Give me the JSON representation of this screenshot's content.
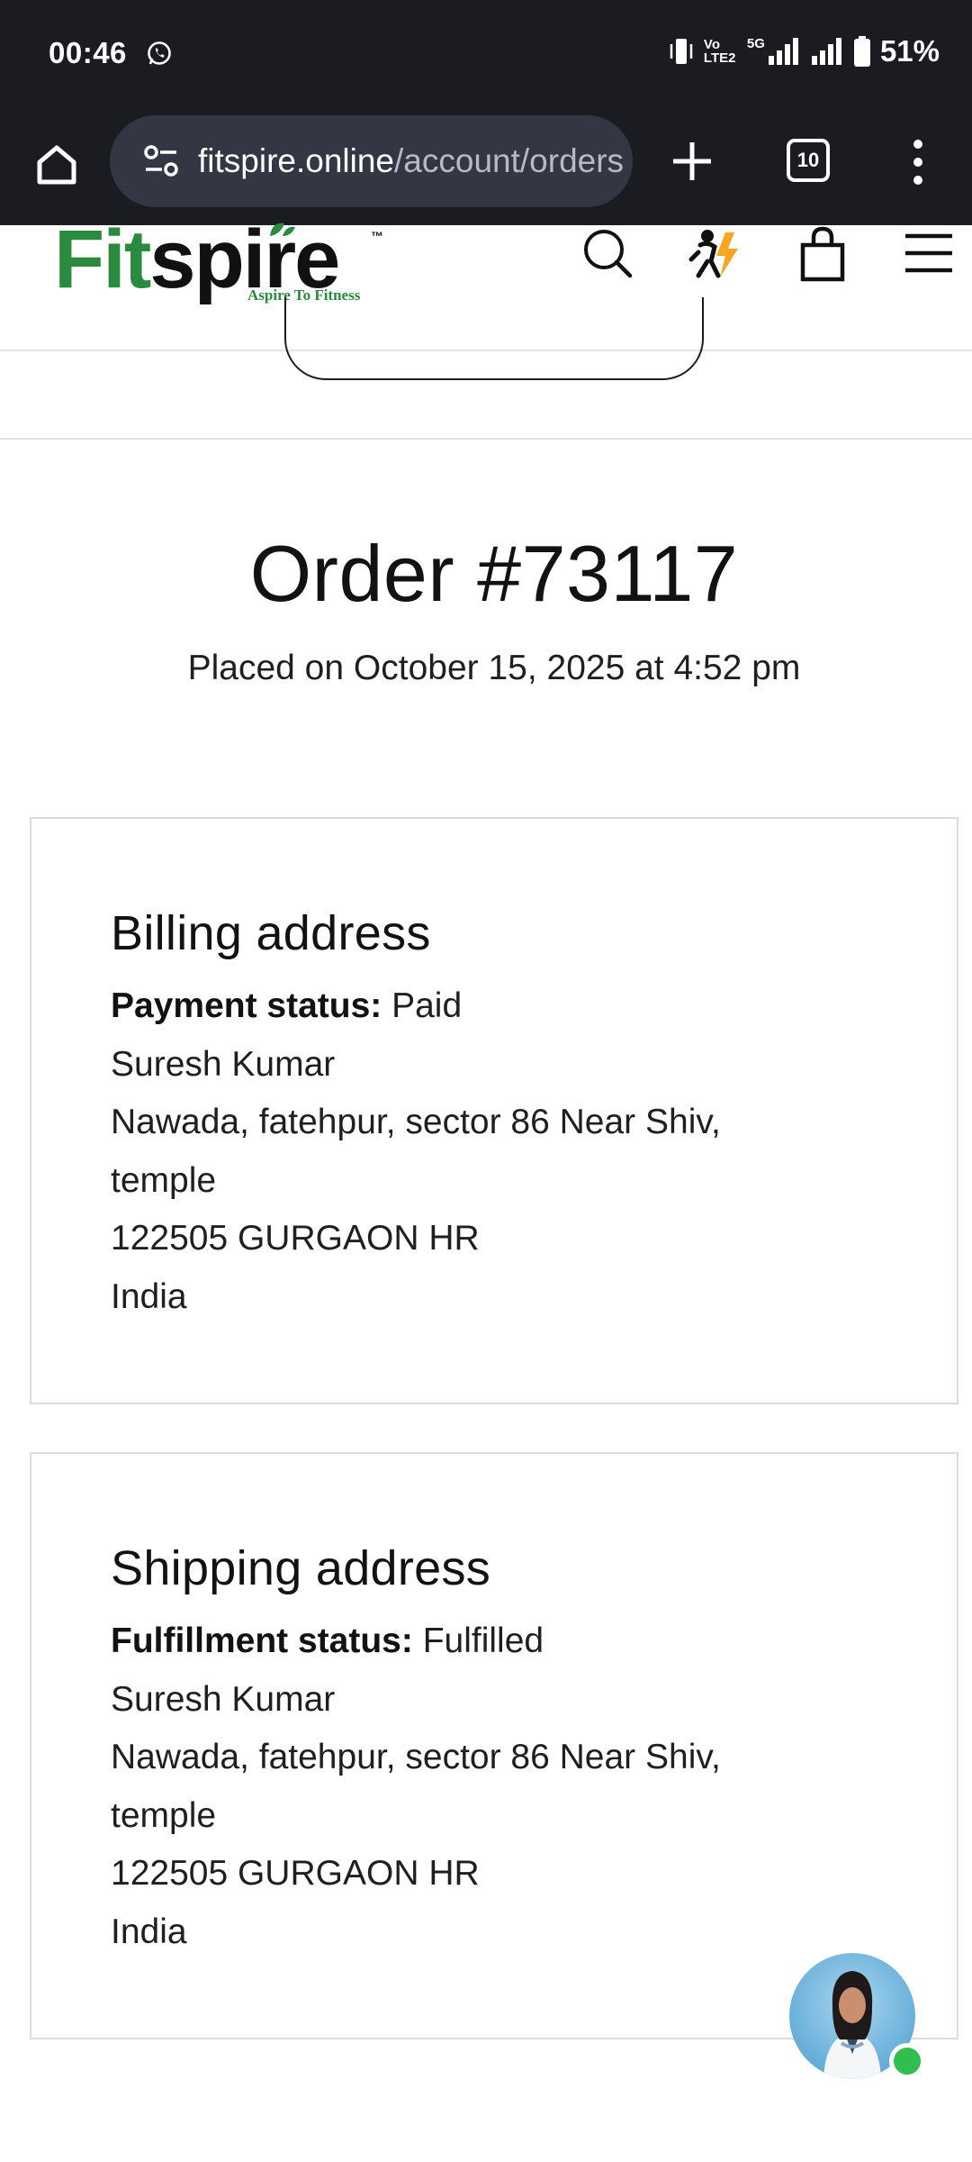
{
  "status_bar": {
    "time": "00:46",
    "network_label": "Vo LTE2",
    "network_type": "5G",
    "battery": "51%",
    "icons": [
      "whatsapp-icon",
      "vibrate-icon",
      "signal-icon",
      "signal-icon",
      "battery-icon"
    ]
  },
  "browser": {
    "url_host": "fitspire.online",
    "url_path": "/account/orders",
    "tab_count": "10",
    "icons": [
      "home-icon",
      "site-settings-icon",
      "plus-icon",
      "tabs-icon",
      "more-vert-icon"
    ]
  },
  "site": {
    "logo_fit": "Fit",
    "logo_spire": "spire",
    "logo_tm": "™",
    "logo_tagline": "Aspire To Fitness",
    "header_icons": [
      "search-icon",
      "coach-icon",
      "bag-icon",
      "menu-icon"
    ]
  },
  "order": {
    "title": "Order #73117",
    "placed_on": "Placed on October 15, 2025 at 4:52 pm"
  },
  "billing": {
    "heading": "Billing address",
    "status_label": "Payment status:",
    "status_value": "Paid",
    "name": "Suresh Kumar",
    "address_line1": "Nawada, fatehpur, sector 86 Near Shiv,",
    "address_line2": "temple",
    "city_line": "122505 GURGAON HR",
    "country": "India"
  },
  "shipping": {
    "heading": "Shipping address",
    "status_label": "Fulfillment status:",
    "status_value": "Fulfilled",
    "name": "Suresh Kumar",
    "address_line1": "Nawada, fatehpur, sector 86 Near Shiv,",
    "address_line2": "temple",
    "city_line": "122505 GURGAON HR",
    "country": "India"
  },
  "colors": {
    "status_bar_bg": "#1b1c21",
    "url_box_bg": "#333743",
    "brand_green": "#2a8a3e",
    "online_green": "#2fbf4f",
    "card_border": "#dcdcdc"
  }
}
